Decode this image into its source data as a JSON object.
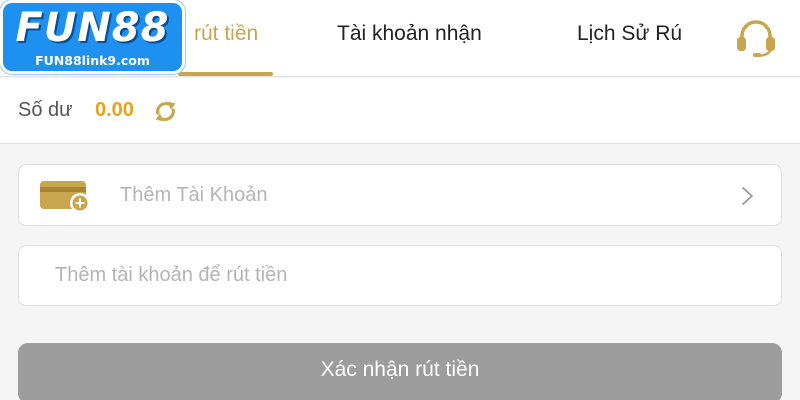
{
  "logo": {
    "word": "FUN88",
    "sub": "FUN88link9.com"
  },
  "tabs": [
    {
      "label": "rút tiền",
      "active": true
    },
    {
      "label": "Tài khoản nhận",
      "active": false
    },
    {
      "label": "Lịch Sử Rú",
      "active": false
    }
  ],
  "header": {
    "support_icon": "headset-icon"
  },
  "balance": {
    "label": "Số dư",
    "value": "0.00",
    "refresh_icon": "refresh-icon"
  },
  "add_account": {
    "icon": "wallet-plus-icon",
    "label": "Thêm Tài Khoản",
    "chevron_icon": "chevron-right-icon"
  },
  "account_input": {
    "value": "",
    "placeholder": "Thêm tài khoản để rút tiền"
  },
  "confirm_button": {
    "label": "Xác nhận rút tiền"
  },
  "colors": {
    "accent": "#c9a550",
    "balance_value": "#e8a31d",
    "logo_blue": "#1e90f0",
    "button_disabled": "#9c9c9c",
    "placeholder": "#b4b4b4"
  }
}
